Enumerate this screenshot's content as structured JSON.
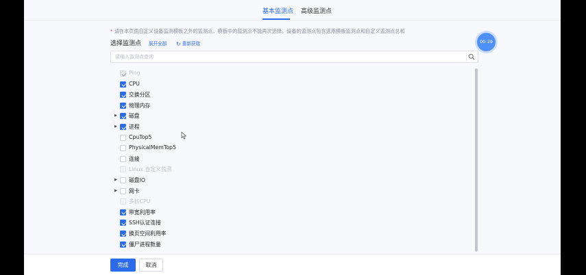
{
  "tabs": [
    {
      "label": "基本监测点",
      "active": true
    },
    {
      "label": "高级监测点",
      "active": false
    }
  ],
  "tip": {
    "star": "*",
    "text": "请在本页面自定义设备监测模板之外的监测点，模板中的监测点不能再次选择。设备的监测点包含选用模板监测点和自定义监测点总和"
  },
  "select_title": "选择监测点",
  "links": {
    "expand_all": "展开全部",
    "refresh": "重新获取"
  },
  "search": {
    "placeholder": "请输入监测点查询",
    "value": ""
  },
  "timer": "00:29",
  "tree_items": [
    {
      "label": "Ping",
      "checked": true,
      "disabled": true,
      "expandable": false
    },
    {
      "label": "CPU",
      "checked": true,
      "disabled": false,
      "expandable": false
    },
    {
      "label": "交换分区",
      "checked": true,
      "disabled": false,
      "expandable": false
    },
    {
      "label": "物理内存",
      "checked": true,
      "disabled": false,
      "expandable": false
    },
    {
      "label": "磁盘",
      "checked": true,
      "disabled": false,
      "expandable": true
    },
    {
      "label": "进程",
      "checked": true,
      "disabled": false,
      "expandable": true
    },
    {
      "label": "CpuTop5",
      "checked": false,
      "disabled": false,
      "expandable": false
    },
    {
      "label": "PhysicalMemTop5",
      "checked": false,
      "disabled": false,
      "expandable": false
    },
    {
      "label": "连接",
      "checked": false,
      "disabled": false,
      "expandable": false
    },
    {
      "label": "Linux 自定义监测",
      "checked": false,
      "disabled": true,
      "expandable": false
    },
    {
      "label": "磁盘IO",
      "checked": false,
      "disabled": false,
      "expandable": true
    },
    {
      "label": "网卡",
      "checked": false,
      "disabled": false,
      "expandable": true
    },
    {
      "label": "多核CPU",
      "checked": false,
      "disabled": true,
      "expandable": false
    },
    {
      "label": "带宽利用率",
      "checked": true,
      "disabled": false,
      "expandable": false
    },
    {
      "label": "SSH认证连接",
      "checked": true,
      "disabled": false,
      "expandable": false
    },
    {
      "label": "换页空间利用率",
      "checked": true,
      "disabled": false,
      "expandable": false
    },
    {
      "label": "僵尸进程数量",
      "checked": true,
      "disabled": false,
      "expandable": false
    }
  ],
  "footer": {
    "confirm_label": "完成",
    "cancel_label": "取消"
  },
  "colors": {
    "accent": "#2c6bea",
    "timer": "#4f90f7"
  }
}
